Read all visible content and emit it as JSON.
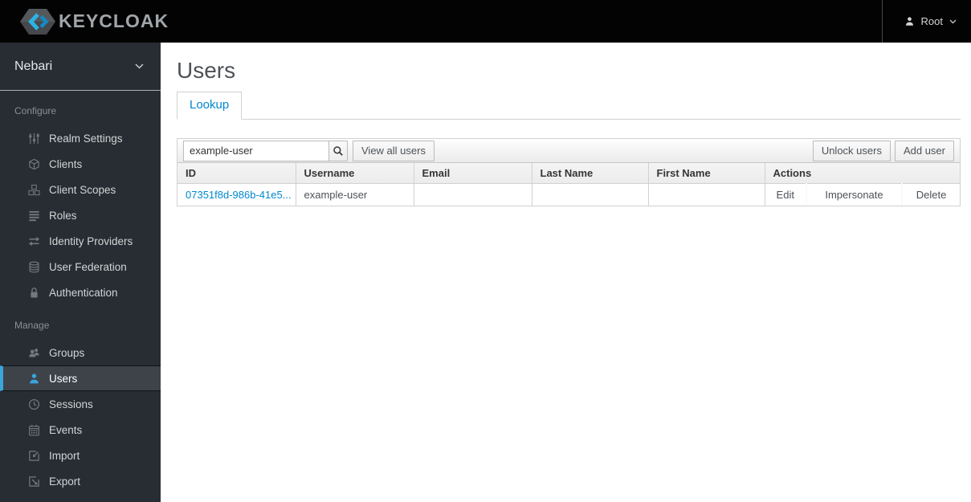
{
  "topbar": {
    "brand": "KEYCLOAK",
    "user_label": "Root"
  },
  "sidebar": {
    "realm_name": "Nebari",
    "sections": [
      {
        "label": "Configure",
        "items": [
          {
            "label": "Realm Settings",
            "icon": "sliders-icon"
          },
          {
            "label": "Clients",
            "icon": "cube-icon"
          },
          {
            "label": "Client Scopes",
            "icon": "cubes-icon"
          },
          {
            "label": "Roles",
            "icon": "list-icon"
          },
          {
            "label": "Identity Providers",
            "icon": "exchange-arrows-icon"
          },
          {
            "label": "User Federation",
            "icon": "database-icon"
          },
          {
            "label": "Authentication",
            "icon": "lock-icon"
          }
        ]
      },
      {
        "label": "Manage",
        "items": [
          {
            "label": "Groups",
            "icon": "group-icon"
          },
          {
            "label": "Users",
            "icon": "user-icon",
            "selected": true
          },
          {
            "label": "Sessions",
            "icon": "clock-icon"
          },
          {
            "label": "Events",
            "icon": "calendar-icon"
          },
          {
            "label": "Import",
            "icon": "import-icon"
          },
          {
            "label": "Export",
            "icon": "export-icon"
          }
        ]
      }
    ]
  },
  "main": {
    "title": "Users",
    "tabs": [
      {
        "label": "Lookup",
        "active": true
      }
    ],
    "toolbar": {
      "search_value": "example-user",
      "search_icon": "magnifier-icon",
      "view_all_label": "View all users",
      "unlock_label": "Unlock users",
      "add_label": "Add user"
    },
    "table": {
      "columns": [
        "ID",
        "Username",
        "Email",
        "Last Name",
        "First Name",
        "Actions"
      ],
      "rows": [
        {
          "id": "07351f8d-986b-41e5...",
          "username": "example-user",
          "email": "",
          "last_name": "",
          "first_name": "",
          "actions": [
            "Edit",
            "Impersonate",
            "Delete"
          ]
        }
      ]
    }
  },
  "colors": {
    "link_blue": "#0088ce",
    "selected_nav_blue": "#39a5dc",
    "topbar_bg": "#030303",
    "sidebar_bg": "#282d33"
  }
}
